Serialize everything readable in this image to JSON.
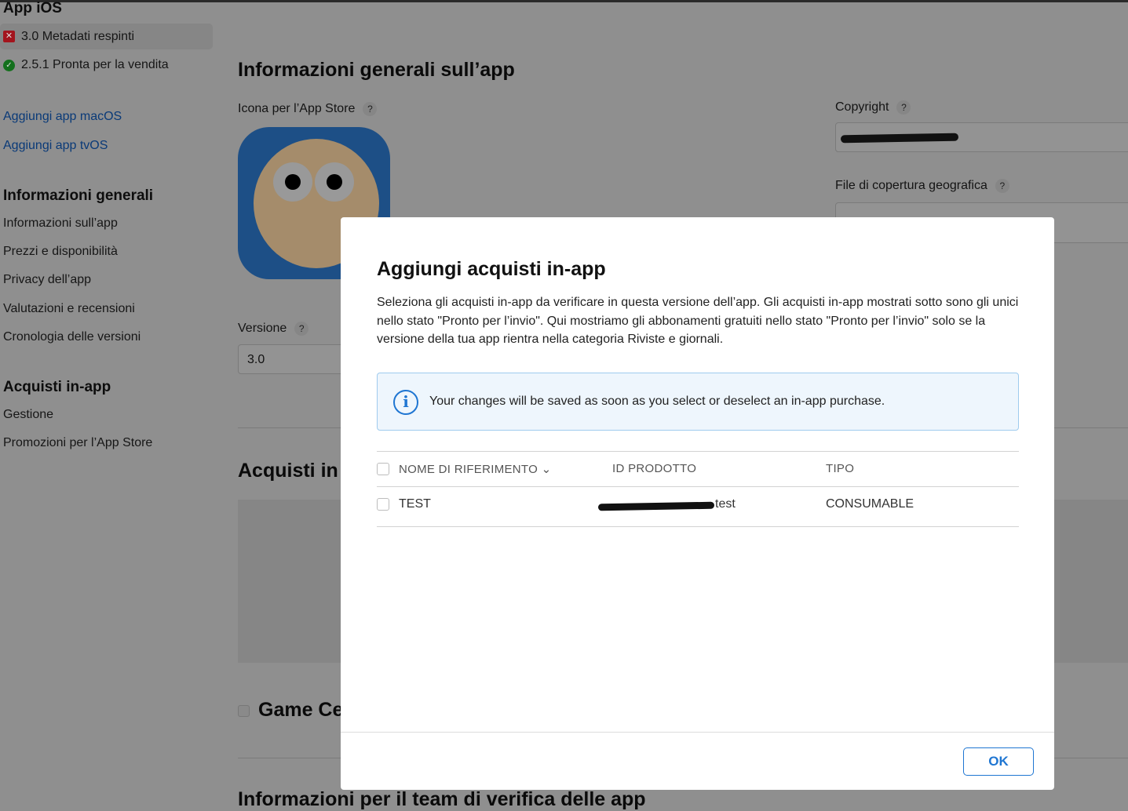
{
  "sidebar": {
    "section_ios": "App iOS",
    "versions": [
      {
        "label": "3.0 Metadati respinti",
        "status": "rejected"
      },
      {
        "label": "2.5.1 Pronta per la vendita",
        "status": "ready"
      }
    ],
    "links": [
      "Aggiungi app macOS",
      "Aggiungi app tvOS"
    ],
    "general_title": "Informazioni generali",
    "general_items": [
      "Informazioni sull’app",
      "Prezzi e disponibilità",
      "Privacy dell’app",
      "Valutazioni e recensioni",
      "Cronologia delle versioni"
    ],
    "iap_title": "Acquisti in-app",
    "iap_items": [
      "Gestione",
      "Promozioni per l’App Store"
    ]
  },
  "main": {
    "title": "Informazioni generali sull’app",
    "icon_label": "Icona per l’App Store",
    "help": "?",
    "copyright_label": "Copyright",
    "geo_label": "File di copertura geografica",
    "version_label": "Versione",
    "version_value": "3.0",
    "iap_section": "Acquisti in",
    "game_center": "Game Ce",
    "review_section": "Informazioni per il team di verifica delle app"
  },
  "modal": {
    "title": "Aggiungi acquisti in-app",
    "description": "Seleziona gli acquisti in-app da verificare in questa versione dell’app. Gli acquisti in-app mostrati sotto sono gli unici nello stato \"Pronto per l’invio\". Qui mostriamo gli abbonamenti gratuiti nello stato \"Pronto per l’invio\" solo se la versione della tua app rientra nella categoria Riviste e giornali.",
    "info": "Your changes will be saved as soon as you select or deselect an in-app purchase.",
    "columns": [
      "NOME DI RIFERIMENTO",
      "ID PRODOTTO",
      "TIPO"
    ],
    "rows": [
      {
        "name": "TEST",
        "product_id_suffix": "test",
        "type": "CONSUMABLE"
      }
    ],
    "ok": "OK"
  },
  "colors": {
    "accent": "#1f76d2",
    "rejected": "#b3141e",
    "ready": "#14791f"
  }
}
